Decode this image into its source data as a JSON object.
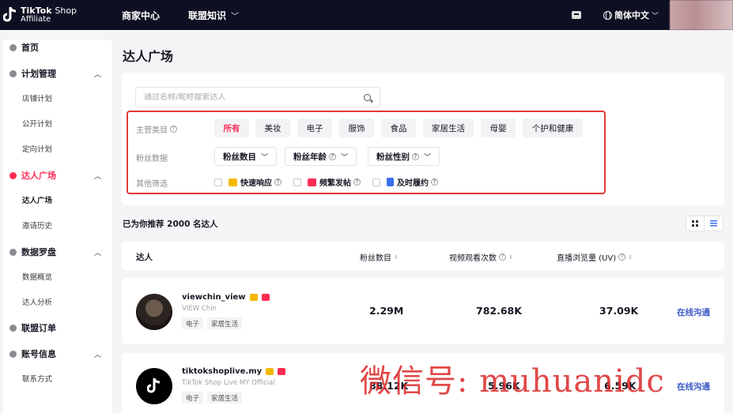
{
  "topbar": {
    "logo_line1_brand": "TikTok",
    "logo_line1_shop": "Shop",
    "logo_line2": "Affiliate",
    "nav": [
      "商家中心",
      "联盟知识"
    ],
    "language": "简体中文"
  },
  "sidebar": {
    "groups": [
      {
        "label": "首页",
        "icon": "home-icon"
      },
      {
        "label": "计划管理",
        "icon": "plan-icon",
        "items": [
          "店铺计划",
          "公开计划",
          "定向计划"
        ]
      },
      {
        "label": "达人广场",
        "icon": "creator-icon",
        "items": [
          "达人广场",
          "邀请历史"
        ]
      },
      {
        "label": "数据罗盘",
        "icon": "compass-icon",
        "items": [
          "数据概览",
          "达人分析"
        ]
      },
      {
        "label": "联盟订单",
        "icon": "order-icon"
      },
      {
        "label": "账号信息",
        "icon": "account-icon",
        "items": [
          "联系方式"
        ]
      }
    ]
  },
  "main": {
    "title": "达人广场",
    "search_placeholder": "通过名称/昵称搜索达人",
    "filters": {
      "category_label": "主营类目",
      "categories": [
        "所有",
        "美妆",
        "电子",
        "服饰",
        "食品",
        "家居生活",
        "母婴",
        "个护和健康"
      ],
      "fans_label": "粉丝数据",
      "fans_dropdowns": [
        "粉丝数目",
        "粉丝年龄",
        "粉丝性别"
      ],
      "other_label": "其他筛选",
      "other_options": [
        "快速响应",
        "频繁发帖",
        "及时履约"
      ]
    },
    "recommend_text": "已为你推荐 2000 名达人",
    "table_headers": [
      "达人",
      "粉丝数目",
      "视频观看次数",
      "直播浏览量 (UV)"
    ],
    "rows": [
      {
        "name": "viewchin_view",
        "sub": "VIEW Chin",
        "tags": [
          "电子",
          "家居生活"
        ],
        "followers": "2.29M",
        "video_views": "782.68K",
        "live_uv": "37.09K",
        "action": "在线沟通"
      },
      {
        "name": "tiktokshoplive.my",
        "sub": "TikTok Shop Live MY Official",
        "tags": [
          "电子",
          "家居生活"
        ],
        "followers": "88.12K",
        "video_views": "5.96K",
        "live_uv": "6.59K",
        "action": "在线沟通"
      }
    ]
  },
  "watermark": "微信号: muhuanidc",
  "colors": {
    "accent": "#fe2c55",
    "topbar": "#0f0f23",
    "link": "#3c5ac8",
    "highlight_box": "#e23a3a"
  }
}
